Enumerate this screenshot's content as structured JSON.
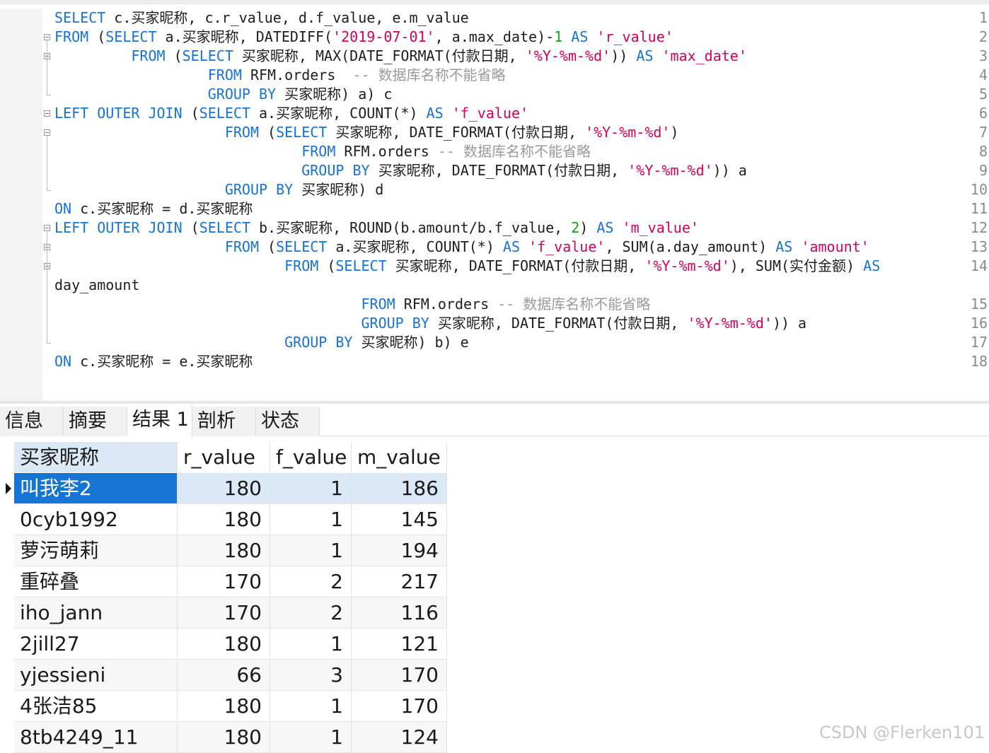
{
  "editor": {
    "lines": [
      {
        "n": "1",
        "segs": [
          [
            "kw",
            "SELECT"
          ],
          [
            "t",
            " c.买家昵称, c.r_value, d.f_value, e.m_value"
          ]
        ]
      },
      {
        "n": "2",
        "segs": [
          [
            "kw",
            "FROM"
          ],
          [
            "t",
            " ("
          ],
          [
            "kw",
            "SELECT"
          ],
          [
            "t",
            " a.买家昵称, DATEDIFF("
          ],
          [
            "str",
            "'2019-07-01'"
          ],
          [
            "t",
            ", a.max_date)-"
          ],
          [
            "num",
            "1"
          ],
          [
            "t",
            " "
          ],
          [
            "kw",
            "AS"
          ],
          [
            "t",
            " "
          ],
          [
            "str",
            "'r_value'"
          ]
        ]
      },
      {
        "n": "3",
        "segs": [
          [
            "t",
            "         "
          ],
          [
            "kw",
            "FROM"
          ],
          [
            "t",
            " ("
          ],
          [
            "kw",
            "SELECT"
          ],
          [
            "t",
            " 买家昵称, MAX(DATE_FORMAT(付款日期, "
          ],
          [
            "str",
            "'%Y-%m-%d'"
          ],
          [
            "t",
            ")) "
          ],
          [
            "kw",
            "AS"
          ],
          [
            "t",
            " "
          ],
          [
            "str",
            "'max_date'"
          ]
        ]
      },
      {
        "n": "4",
        "segs": [
          [
            "t",
            "                  "
          ],
          [
            "kw",
            "FROM"
          ],
          [
            "t",
            " RFM.orders  "
          ],
          [
            "cmt",
            "-- 数据库名称不能省略"
          ]
        ]
      },
      {
        "n": "5",
        "segs": [
          [
            "t",
            "                  "
          ],
          [
            "kw",
            "GROUP BY"
          ],
          [
            "t",
            " 买家昵称) a) c"
          ]
        ]
      },
      {
        "n": "6",
        "segs": [
          [
            "kw",
            "LEFT OUTER JOIN"
          ],
          [
            "t",
            " ("
          ],
          [
            "kw",
            "SELECT"
          ],
          [
            "t",
            " a.买家昵称, COUNT(*) "
          ],
          [
            "kw",
            "AS"
          ],
          [
            "t",
            " "
          ],
          [
            "str",
            "'f_value'"
          ]
        ]
      },
      {
        "n": "7",
        "segs": [
          [
            "t",
            "                    "
          ],
          [
            "kw",
            "FROM"
          ],
          [
            "t",
            " ("
          ],
          [
            "kw",
            "SELECT"
          ],
          [
            "t",
            " 买家昵称, DATE_FORMAT(付款日期, "
          ],
          [
            "str",
            "'%Y-%m-%d'"
          ],
          [
            "t",
            ")"
          ]
        ]
      },
      {
        "n": "8",
        "segs": [
          [
            "t",
            "                             "
          ],
          [
            "kw",
            "FROM"
          ],
          [
            "t",
            " RFM.orders "
          ],
          [
            "cmt",
            "-- 数据库名称不能省略"
          ]
        ]
      },
      {
        "n": "9",
        "segs": [
          [
            "t",
            "                             "
          ],
          [
            "kw",
            "GROUP BY"
          ],
          [
            "t",
            " 买家昵称, DATE_FORMAT(付款日期, "
          ],
          [
            "str",
            "'%Y-%m-%d'"
          ],
          [
            "t",
            ")) a"
          ]
        ]
      },
      {
        "n": "10",
        "segs": [
          [
            "t",
            "                    "
          ],
          [
            "kw",
            "GROUP BY"
          ],
          [
            "t",
            " 买家昵称) d"
          ]
        ]
      },
      {
        "n": "11",
        "segs": [
          [
            "kw",
            "ON"
          ],
          [
            "t",
            " c.买家昵称 = d.买家昵称"
          ]
        ]
      },
      {
        "n": "12",
        "segs": [
          [
            "kw",
            "LEFT OUTER JOIN"
          ],
          [
            "t",
            " ("
          ],
          [
            "kw",
            "SELECT"
          ],
          [
            "t",
            " b.买家昵称, ROUND(b.amount/b.f_value, "
          ],
          [
            "num",
            "2"
          ],
          [
            "t",
            ") "
          ],
          [
            "kw",
            "AS"
          ],
          [
            "t",
            " "
          ],
          [
            "str",
            "'m_value'"
          ]
        ]
      },
      {
        "n": "13",
        "segs": [
          [
            "t",
            "                    "
          ],
          [
            "kw",
            "FROM"
          ],
          [
            "t",
            " ("
          ],
          [
            "kw",
            "SELECT"
          ],
          [
            "t",
            " a.买家昵称, COUNT(*) "
          ],
          [
            "kw",
            "AS"
          ],
          [
            "t",
            " "
          ],
          [
            "str",
            "'f_value'"
          ],
          [
            "t",
            ", SUM(a.day_amount) "
          ],
          [
            "kw",
            "AS"
          ],
          [
            "t",
            " "
          ],
          [
            "str",
            "'amount'"
          ]
        ]
      },
      {
        "n": "14",
        "segs": [
          [
            "t",
            "                           "
          ],
          [
            "kw",
            "FROM"
          ],
          [
            "t",
            " ("
          ],
          [
            "kw",
            "SELECT"
          ],
          [
            "t",
            " 买家昵称, DATE_FORMAT(付款日期, "
          ],
          [
            "str",
            "'%Y-%m-%d'"
          ],
          [
            "t",
            "), SUM(实付金额) "
          ],
          [
            "kw",
            "AS"
          ]
        ]
      },
      {
        "n": "",
        "segs": [
          [
            "t",
            "day_amount"
          ]
        ]
      },
      {
        "n": "15",
        "segs": [
          [
            "t",
            "                                    "
          ],
          [
            "kw",
            "FROM"
          ],
          [
            "t",
            " RFM.orders "
          ],
          [
            "cmt",
            "-- 数据库名称不能省略"
          ]
        ]
      },
      {
        "n": "16",
        "segs": [
          [
            "t",
            "                                    "
          ],
          [
            "kw",
            "GROUP BY"
          ],
          [
            "t",
            " 买家昵称, DATE_FORMAT(付款日期, "
          ],
          [
            "str",
            "'%Y-%m-%d'"
          ],
          [
            "t",
            ")) a"
          ]
        ]
      },
      {
        "n": "17",
        "segs": [
          [
            "t",
            "                           "
          ],
          [
            "kw",
            "GROUP BY"
          ],
          [
            "t",
            " 买家昵称) b) e"
          ]
        ]
      },
      {
        "n": "18",
        "segs": [
          [
            "kw",
            "ON"
          ],
          [
            "t",
            " c.买家昵称 = e.买家昵称"
          ]
        ]
      }
    ]
  },
  "tabs": [
    {
      "label": "信息",
      "active": false
    },
    {
      "label": "摘要",
      "active": false
    },
    {
      "label": "结果 1",
      "active": true
    },
    {
      "label": "剖析",
      "active": false
    },
    {
      "label": "状态",
      "active": false
    }
  ],
  "grid": {
    "columns": [
      "买家昵称",
      "r_value",
      "f_value",
      "m_value"
    ],
    "rows": [
      [
        "叫我李2",
        "180",
        "1",
        "186"
      ],
      [
        "0cyb1992",
        "180",
        "1",
        "145"
      ],
      [
        "萝污萌莉",
        "180",
        "1",
        "194"
      ],
      [
        "重碎叠",
        "170",
        "2",
        "217"
      ],
      [
        "iho_jann",
        "170",
        "2",
        "116"
      ],
      [
        "2jill27",
        "180",
        "1",
        "121"
      ],
      [
        "yjessieni",
        "66",
        "3",
        "170"
      ],
      [
        "4张洁85",
        "180",
        "1",
        "170"
      ],
      [
        "8tb4249_11",
        "180",
        "1",
        "124"
      ]
    ],
    "selected_row": 0
  },
  "watermark": "CSDN @Flerken101"
}
